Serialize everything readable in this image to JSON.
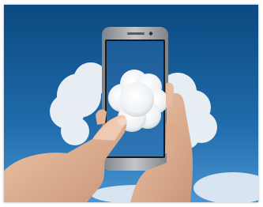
{
  "image": {
    "subject": "hands-holding-smartphone-with-cloud",
    "colors": {
      "sky_top": "#0b4f86",
      "sky_bottom": "#3f8fcf",
      "cloud": "#f4f6f8",
      "phone_body": "#9aa0a6",
      "screen": "#2a6fb0",
      "skin": "#e3b89c"
    }
  }
}
